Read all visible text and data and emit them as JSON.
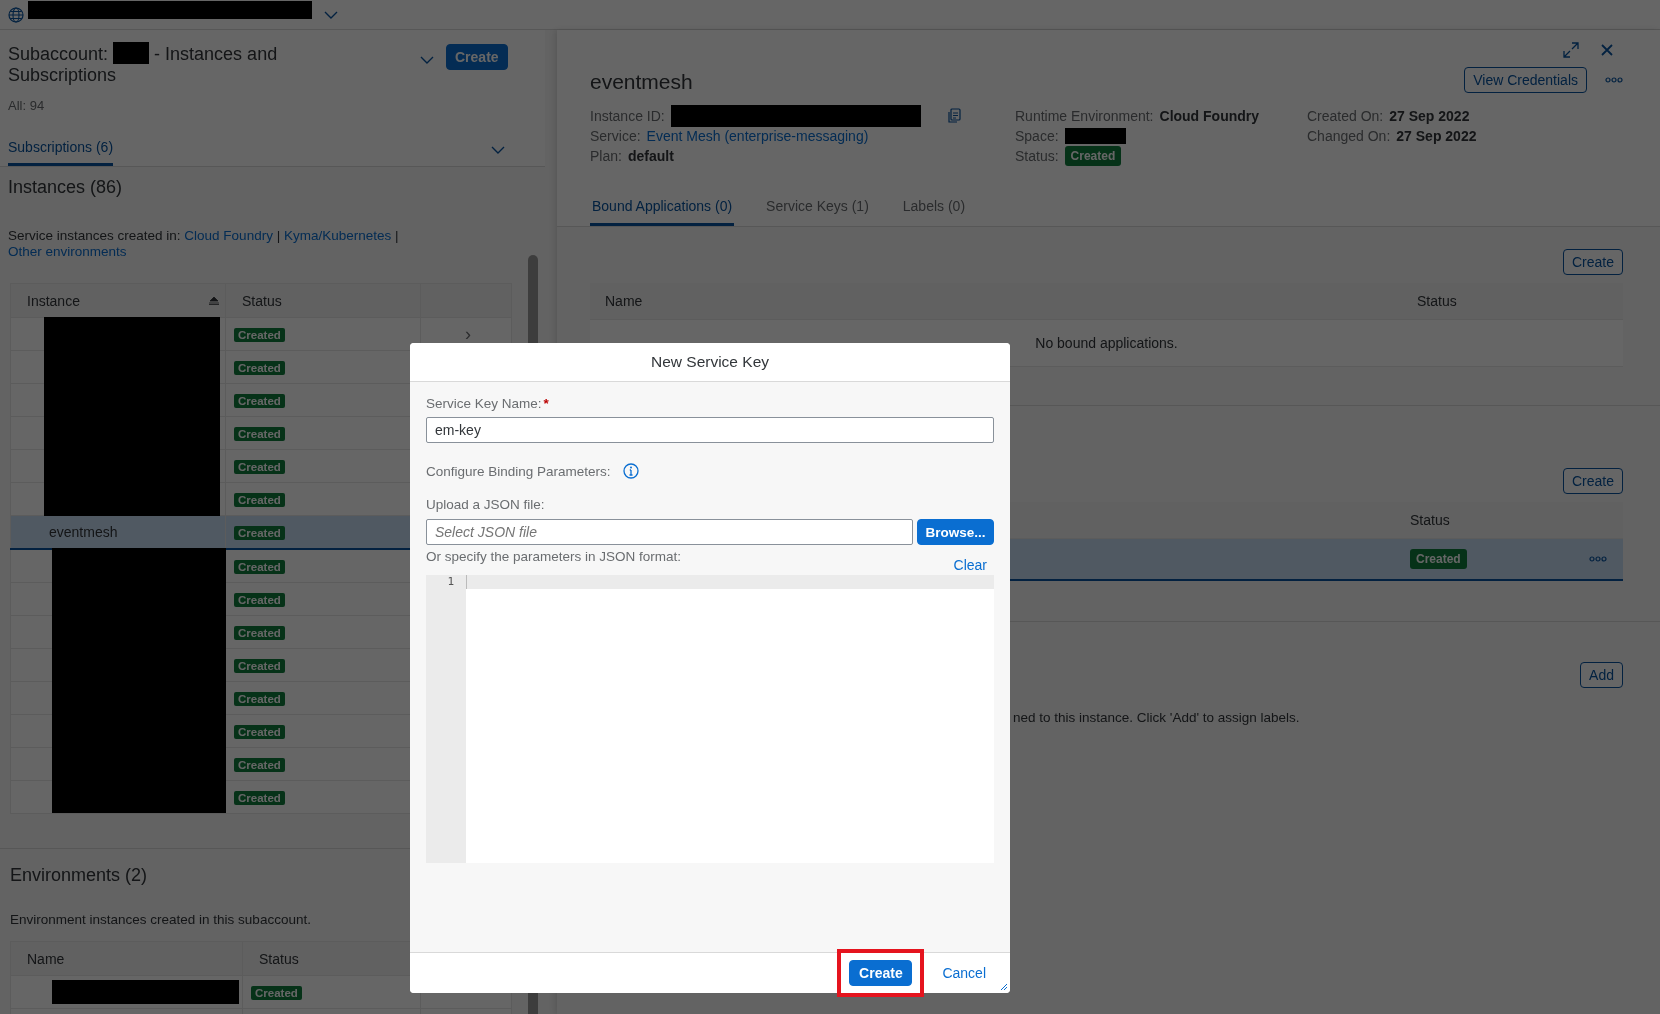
{
  "subaccount": {
    "title_prefix": "Subaccount:",
    "title_suffix": "- Instances and Subscriptions",
    "count": "All: 94",
    "create_button": "Create"
  },
  "subscriptions_tab": {
    "label": "Subscriptions (6)",
    "selected": true
  },
  "instances": {
    "title": "Instances (86)",
    "intro": "Service instances created in:",
    "separator": "|",
    "links": [
      "Cloud Foundry",
      "Kyma/Kubernetes",
      "Other environments"
    ],
    "columns": [
      "Instance",
      "Status"
    ],
    "rows": [
      {
        "kind": "redacted",
        "status": "Created",
        "selected": false,
        "nav_icon": "›"
      },
      {
        "kind": "redacted",
        "status": "Created",
        "selected": false
      },
      {
        "kind": "redacted",
        "status": "Created",
        "selected": false
      },
      {
        "kind": "redacted",
        "status": "Created",
        "selected": false
      },
      {
        "kind": "redacted",
        "status": "Created",
        "selected": false
      },
      {
        "kind": "redacted",
        "status": "Created",
        "selected": false
      },
      {
        "kind": "text",
        "instance": "eventmesh",
        "status": "Created",
        "selected": true
      },
      {
        "kind": "redacted",
        "status": "Created",
        "selected": false
      },
      {
        "kind": "redacted",
        "status": "Created",
        "selected": false
      },
      {
        "kind": "redacted",
        "status": "Created",
        "selected": false
      },
      {
        "kind": "redacted",
        "status": "Created",
        "selected": false
      },
      {
        "kind": "redacted",
        "status": "Created",
        "selected": false
      },
      {
        "kind": "redacted",
        "status": "Created",
        "selected": false
      },
      {
        "kind": "redacted",
        "status": "Created",
        "selected": false
      },
      {
        "kind": "redacted",
        "status": "Created",
        "selected": false
      }
    ]
  },
  "environments": {
    "title": "Environments (2)",
    "intro": "Environment instances created in this subaccount.",
    "columns": [
      "Name",
      "Status"
    ],
    "rows": [
      {
        "kind": "redacted",
        "status": "Created"
      }
    ]
  },
  "detail": {
    "title": "eventmesh",
    "view_credentials": "View Credentials",
    "field_columns": [
      [
        {
          "kind": "redacted",
          "label": "Instance ID:"
        },
        {
          "kind": "link",
          "label": "Service:",
          "value": "Event Mesh (enterprise-messaging)"
        },
        {
          "kind": "value",
          "label": "Plan:",
          "value": "default"
        }
      ],
      [
        {
          "kind": "value",
          "label": "Runtime Environment:",
          "value": "Cloud Foundry"
        },
        {
          "kind": "redacted",
          "label": "Space:"
        },
        {
          "kind": "badge",
          "label": "Status:",
          "value": "Created"
        }
      ],
      [
        {
          "kind": "value",
          "label": "Created On:",
          "value": "27 Sep 2022"
        },
        {
          "kind": "value",
          "label": "Changed On:",
          "value": "27 Sep 2022"
        }
      ]
    ],
    "tabs": [
      {
        "label": "Bound Applications (0)",
        "selected": true
      },
      {
        "label": "Service Keys (1)",
        "selected": false
      },
      {
        "label": "Labels (0)",
        "selected": false
      }
    ],
    "bound_applications": {
      "create_button": "Create",
      "columns": [
        "Name",
        "Status"
      ],
      "empty_text": "No bound applications."
    },
    "service_keys": {
      "create_button": "Create",
      "status_column": "Status",
      "rows": [
        {
          "status": "Created",
          "selected": true
        }
      ]
    },
    "labels": {
      "add_button": "Add",
      "text": "ned to this instance. Click 'Add' to assign labels."
    }
  },
  "dialog": {
    "title": "New Service Key",
    "name_label": "Service Key Name:",
    "required_mark": "*",
    "name_value": "em-key",
    "binding_label": "Configure Binding Parameters:",
    "upload_label": "Upload a JSON file:",
    "file_placeholder": "Select JSON file",
    "browse_button": "Browse...",
    "json_label": "Or specify the parameters in JSON format:",
    "clear_link": "Clear",
    "line_numbers": [
      "1"
    ],
    "buttons": [
      {
        "label": "Create",
        "kind": "primary",
        "highlighted": true
      },
      {
        "label": "Cancel",
        "kind": "link"
      }
    ]
  }
}
